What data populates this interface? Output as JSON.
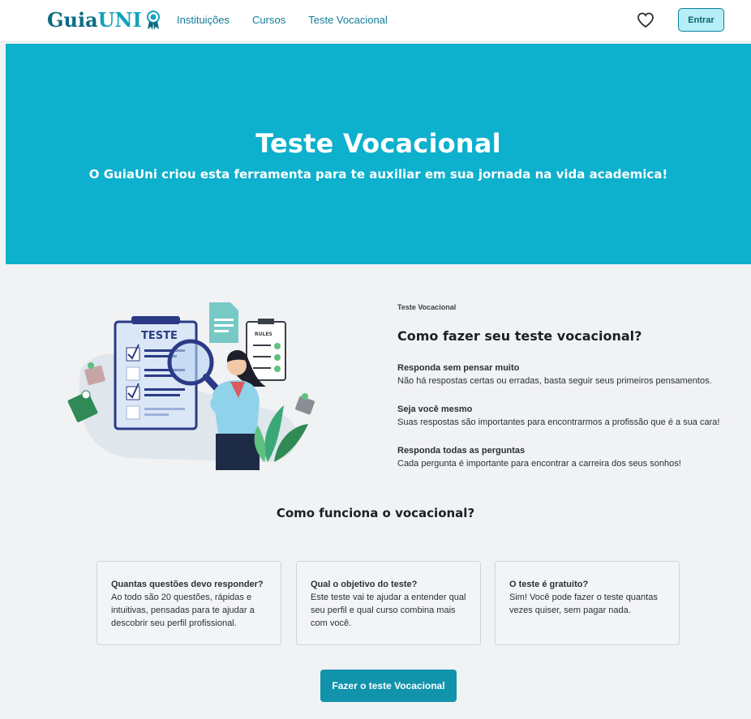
{
  "header": {
    "logo_part1": "Guia",
    "logo_part2": "UNI",
    "nav": [
      "Instituições",
      "Cursos",
      "Teste Vocacional"
    ],
    "login_label": "Entrar",
    "favorites_icon": "heart-icon"
  },
  "hero": {
    "title": "Teste Vocacional",
    "subtitle": "O GuiaUni criou esta ferramenta para te auxiliar em sua jornada na vida academica!"
  },
  "intro": {
    "illustration_texts": [
      "TESTE",
      "RULES"
    ],
    "eyebrow": "Teste Vocacional",
    "title": "Como fazer seu teste vocacional?",
    "tips": [
      {
        "title": "Responda sem pensar muito",
        "text": "Não há respostas certas ou erradas, basta seguir seus primeiros pensamentos."
      },
      {
        "title": "Seja você mesmo",
        "text": "Suas respostas são importantes para encontrarmos a profissão que é a sua cara!"
      },
      {
        "title": "Responda todas as perguntas",
        "text": "Cada pergunta é importante para encontrar a carreira dos seus sonhos!"
      }
    ]
  },
  "how": {
    "title": "Como funciona o vocacional?",
    "cards": [
      {
        "question": "Quantas questões devo responder?",
        "answer": "Ao todo são 20 questões, rápidas e intuitivas, pensadas para te ajudar a descobrir seu perfil profissional."
      },
      {
        "question": "Qual o objetivo do teste?",
        "answer": "Este teste vai te ajudar a entender qual seu perfil e qual curso combina mais com você."
      },
      {
        "question": "O teste é gratuito?",
        "answer": "Sim! Você pode fazer o teste quantas vezes quiser, sem pagar nada."
      }
    ],
    "cta_label": "Fazer o teste Vocacional"
  },
  "colors": {
    "hero_bg": "#0db0cd",
    "brand_dark": "#0e6c84",
    "brand_light": "#13a2bf",
    "cta_bg": "#1193ab"
  }
}
